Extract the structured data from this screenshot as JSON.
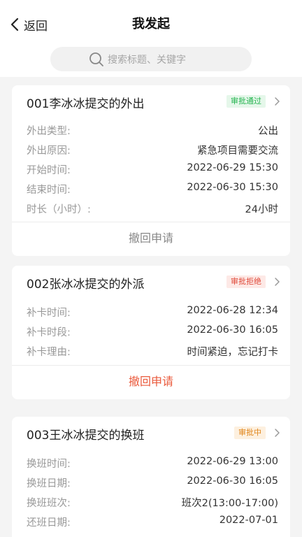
{
  "header": {
    "back_label": "返回",
    "title": "我发起",
    "search_placeholder": "搜索标题、关键字"
  },
  "colors": {
    "approved_text": "#24b44f",
    "approved_bg": "#e5f7ea",
    "rejected_text": "#e04a3a",
    "rejected_bg": "#fde9e6",
    "pending_text": "#e0851a",
    "pending_bg": "#fdf0df",
    "withdraw_active": "#ea5a3c",
    "withdraw_muted": "#888888"
  },
  "cards": [
    {
      "title": "001李冰冰提交的外出",
      "status": "审批通过",
      "rows": [
        {
          "label": "外出类型:",
          "value": "公出"
        },
        {
          "label": "外出原因:",
          "value": "紧急项目需要交流"
        },
        {
          "label": "开始时间:",
          "value": "2022-06-29 15:30"
        },
        {
          "label": "结束时间:",
          "value": "2022-06-30 15:30"
        },
        {
          "label": "时长（小时）:",
          "value": "24小时"
        }
      ],
      "action": "撤回申请"
    },
    {
      "title": "002张冰冰提交的外派",
      "status": "审批拒绝",
      "rows": [
        {
          "label": "补卡时间:",
          "value": "2022-06-28 12:34"
        },
        {
          "label": "补卡时段:",
          "value": "2022-06-30 16:05"
        },
        {
          "label": "补卡理由:",
          "value": "时间紧迫，忘记打卡"
        }
      ],
      "action": "撤回申请"
    },
    {
      "title": "003王冰冰提交的换班",
      "status": "审批中",
      "rows": [
        {
          "label": "换班时间:",
          "value": "2022-06-29 13:00"
        },
        {
          "label": "换班日期:",
          "value": "2022-06-30 16:05"
        },
        {
          "label": "换班班次:",
          "value": "班次2(13:00-17:00)"
        },
        {
          "label": "还班日期:",
          "value": "2022-07-01"
        }
      ]
    }
  ]
}
